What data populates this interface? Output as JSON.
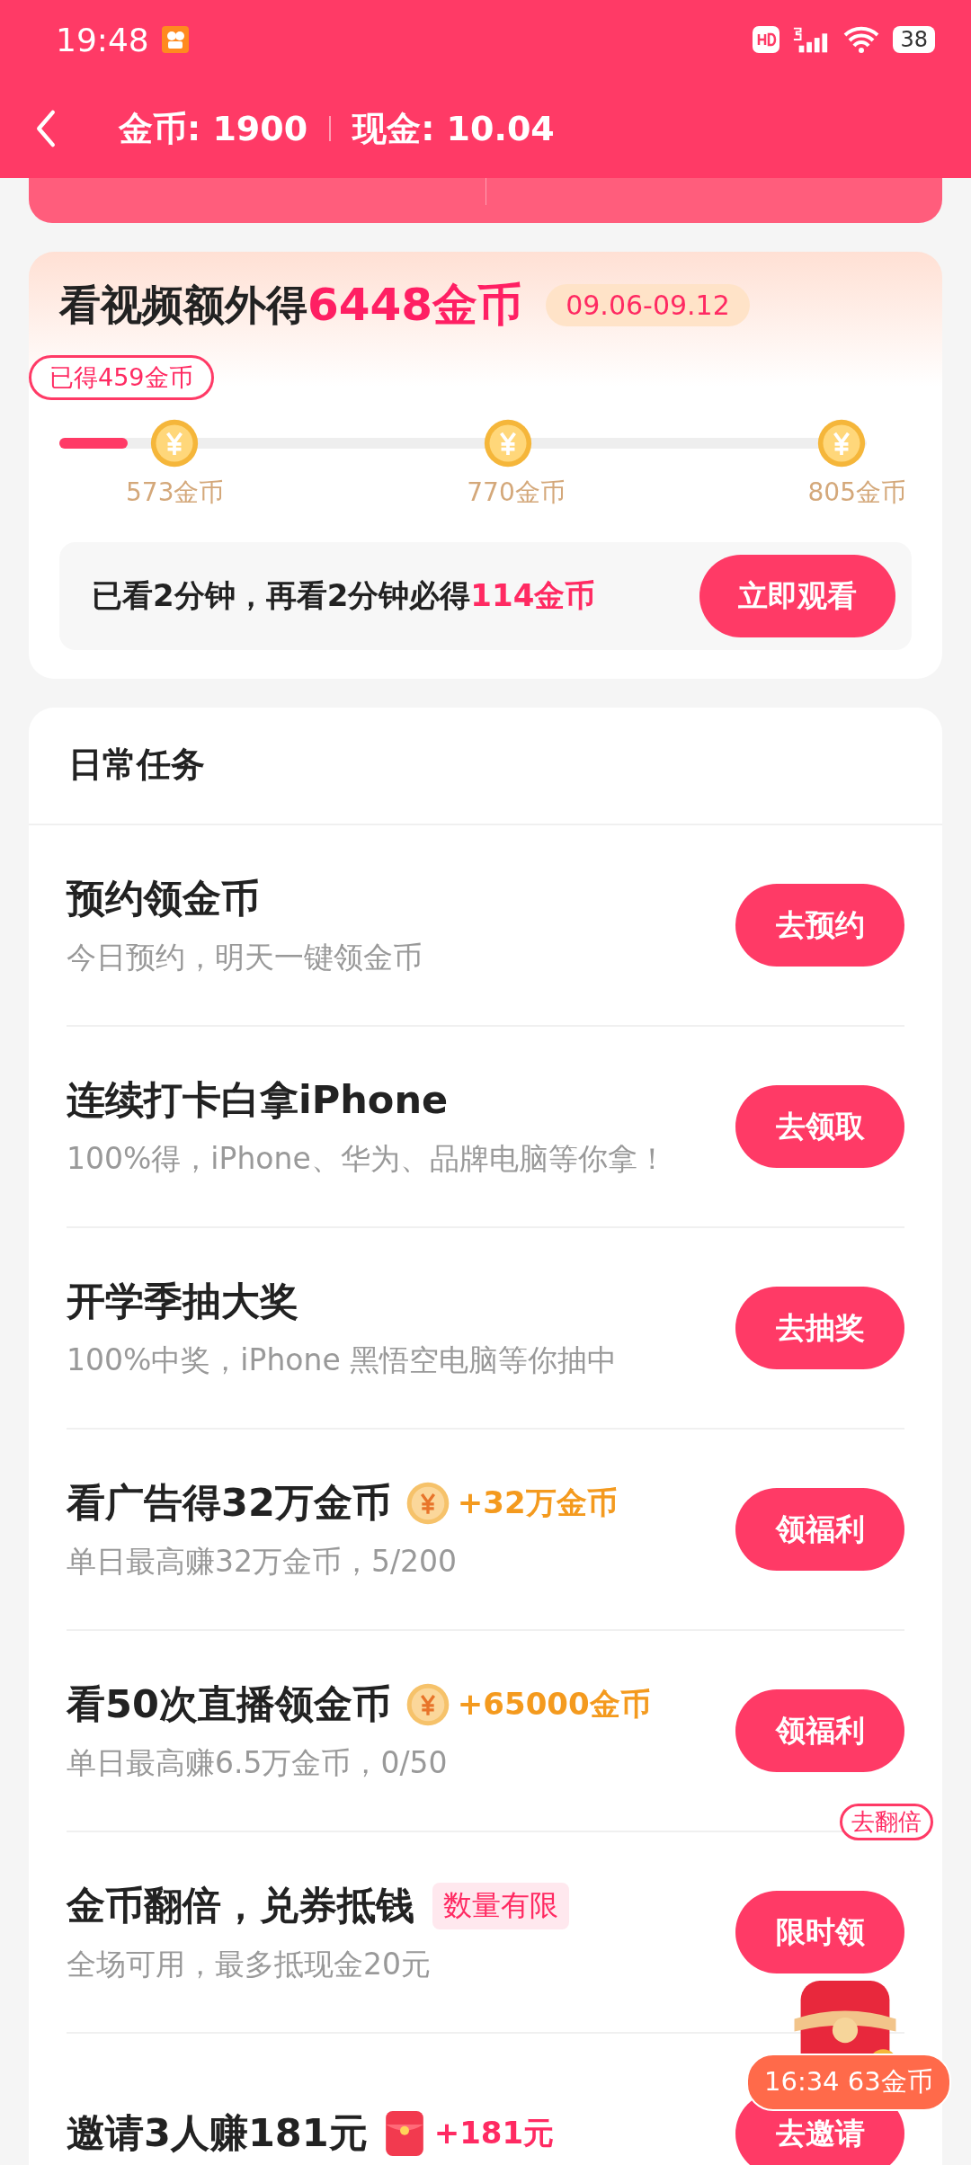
{
  "status_bar": {
    "time": "19:48",
    "battery": "38"
  },
  "header": {
    "coins": "金币: 1900",
    "cash": "现金: 10.04"
  },
  "video_card": {
    "title": "看视频额外得",
    "reward": "6448金币",
    "dates": "09.06-09.12",
    "earned": "已得459金币",
    "level": 0.085,
    "milestones": [
      {
        "label": "573金币"
      },
      {
        "label": "770金币"
      },
      {
        "label": "805金币"
      }
    ],
    "tip_prefix": "已看2分钟，再看2分钟必得",
    "tip_reward": "114金币",
    "button": "立即观看"
  },
  "tasks": {
    "title": "日常任务",
    "items": [
      {
        "kind": "plain",
        "title": "预约领金币",
        "subtitle": "今日预约，明天一键领金币",
        "button": "去预约"
      },
      {
        "kind": "plain",
        "title": "连续打卡白拿iPhone",
        "subtitle": "100%得，iPhone、华为、品牌电脑等你拿！",
        "button": "去领取"
      },
      {
        "kind": "plain",
        "title": "开学季抽大奖",
        "subtitle": "100%中奖，iPhone 黑悟空电脑等你抽中",
        "button": "去抽奖"
      },
      {
        "kind": "coin",
        "title": "看广告得32万金币",
        "extra": "+32万金币",
        "subtitle": "单日最高赚32万金币，5/200",
        "button": "领福利"
      },
      {
        "kind": "coin",
        "title": "看50次直播领金币",
        "extra": "+65000金币",
        "subtitle": "单日最高赚6.5万金币，0/50",
        "button": "领福利"
      },
      {
        "kind": "tag",
        "title": "金币翻倍，兑券抵钱",
        "extra": "数量有限",
        "subtitle": "全场可用，最多抵现金20元",
        "button": "限时领"
      },
      {
        "kind": "packet",
        "title": "邀请3人赚181元",
        "extra": "+181元",
        "button": "去邀请"
      }
    ]
  },
  "floating": {
    "tag": "去翻倍",
    "timer": "16:34 63金币"
  }
}
